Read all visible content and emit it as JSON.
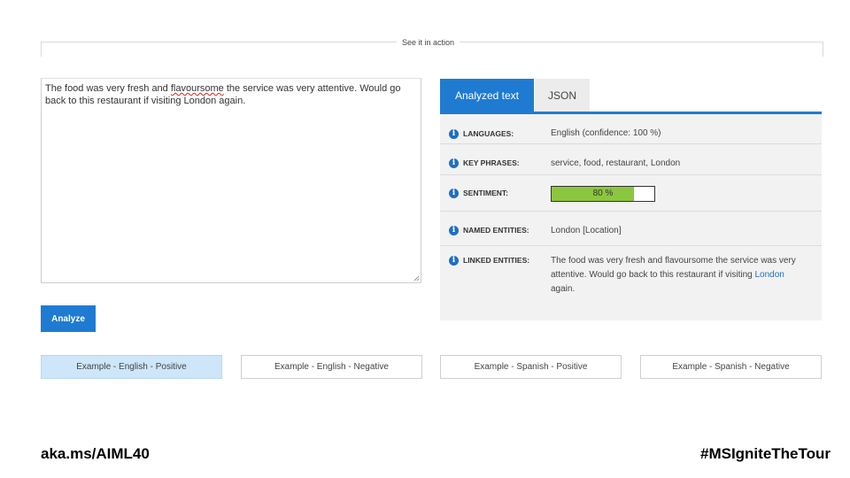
{
  "section": {
    "title": "See it in action"
  },
  "input": {
    "text_before": "The food was very fresh and ",
    "misspelled_word": "flavoursome",
    "text_after": " the service was very attentive. Would go back to this restaurant if visiting London again."
  },
  "analyze_button": "Analyze",
  "tabs": [
    {
      "label": "Analyzed text",
      "active": true
    },
    {
      "label": "JSON",
      "active": false
    }
  ],
  "results": {
    "languages": {
      "label": "LANGUAGES:",
      "value": "English (confidence: 100 %)"
    },
    "key_phrases": {
      "label": "KEY PHRASES:",
      "value": "service, food, restaurant, London"
    },
    "sentiment": {
      "label": "SENTIMENT:",
      "score_percent": 80,
      "text": "80 %"
    },
    "named_entities": {
      "label": "NAMED ENTITIES:",
      "value": "London [Location]"
    },
    "linked_entities": {
      "label": "LINKED ENTITIES:",
      "text_before": "The food was very fresh and flavoursome the service was very attentive. Would go back to this restaurant if visiting ",
      "link_text": "London",
      "text_after": " again."
    }
  },
  "examples": [
    {
      "label": "Example - English - Positive",
      "selected": true
    },
    {
      "label": "Example - English - Negative",
      "selected": false
    },
    {
      "label": "Example - Spanish - Positive",
      "selected": false
    },
    {
      "label": "Example - Spanish - Negative",
      "selected": false
    }
  ],
  "footer": {
    "left": "aka.ms/AIML40",
    "right": "#MSIgniteTheTour"
  },
  "colors": {
    "accent": "#1f7bd1",
    "sentiment_fill": "#8cc63f",
    "selected_example": "#cde6f9",
    "panel_bg": "#f2f2f2"
  },
  "icons": {
    "info": "info-circle-icon"
  }
}
